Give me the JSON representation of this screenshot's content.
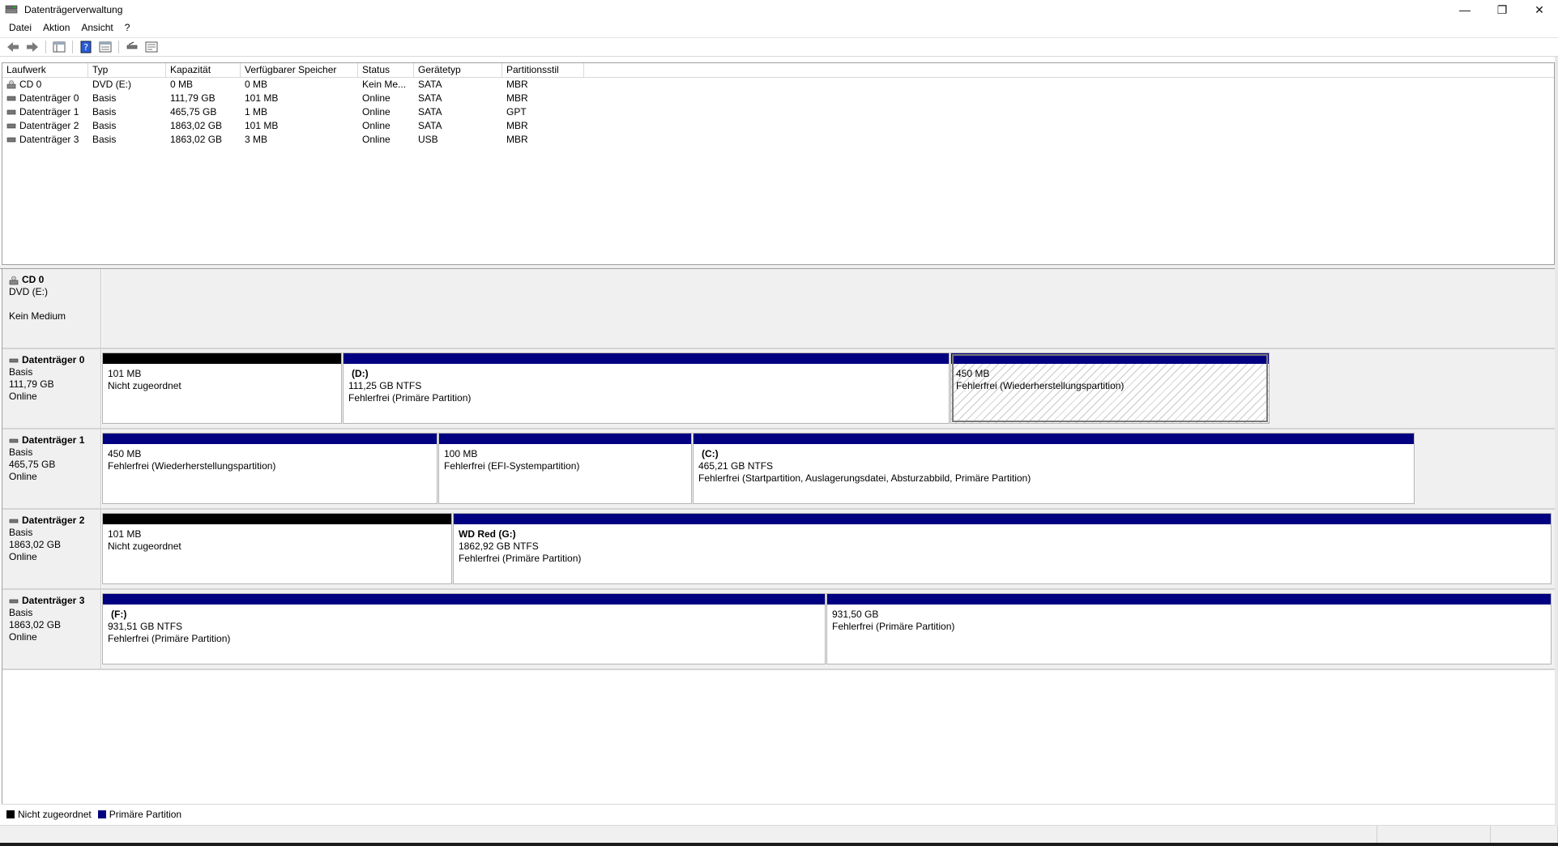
{
  "window": {
    "title": "Datenträgerverwaltung",
    "minimize": "—",
    "restore": "❐",
    "close": "✕"
  },
  "menu": [
    "Datei",
    "Aktion",
    "Ansicht",
    "?"
  ],
  "toolbar": {
    "icons": [
      "back-arrow-icon",
      "forward-arrow-icon",
      "console-view-icon",
      "help-icon",
      "properties-view-icon",
      "rescan-icon",
      "settings-view-icon"
    ]
  },
  "listview": {
    "columns": [
      "Laufwerk",
      "Typ",
      "Kapazität",
      "Verfügbarer Speicher",
      "Status",
      "Gerätetyp",
      "Partitionsstil"
    ],
    "rows": [
      {
        "name": "CD 0",
        "icon": "cd-drive-icon",
        "typ": "DVD (E:)",
        "kapazitaet": "0 MB",
        "frei": "0 MB",
        "status": "Kein Me...",
        "geraetetyp": "SATA",
        "stil": "MBR"
      },
      {
        "name": "Datenträger 0",
        "icon": "disk-icon",
        "typ": "Basis",
        "kapazitaet": "111,79 GB",
        "frei": "101 MB",
        "status": "Online",
        "geraetetyp": "SATA",
        "stil": "MBR"
      },
      {
        "name": "Datenträger 1",
        "icon": "disk-icon",
        "typ": "Basis",
        "kapazitaet": "465,75 GB",
        "frei": "1 MB",
        "status": "Online",
        "geraetetyp": "SATA",
        "stil": "GPT"
      },
      {
        "name": "Datenträger 2",
        "icon": "disk-icon",
        "typ": "Basis",
        "kapazitaet": "1863,02 GB",
        "frei": "101 MB",
        "status": "Online",
        "geraetetyp": "SATA",
        "stil": "MBR"
      },
      {
        "name": "Datenträger 3",
        "icon": "disk-icon",
        "typ": "Basis",
        "kapazitaet": "1863,02 GB",
        "frei": "3 MB",
        "status": "Online",
        "geraetetyp": "USB",
        "stil": "MBR"
      }
    ]
  },
  "disks": {
    "cd0": {
      "name": "CD 0",
      "line1": "DVD (E:)",
      "line2": "",
      "line3": "Kein Medium"
    },
    "d0": {
      "name": "Datenträger 0",
      "line1": "Basis",
      "line2": "111,79 GB",
      "line3": "Online",
      "parts": [
        {
          "title": "",
          "size": "101 MB",
          "status": "Nicht zugeordnet"
        },
        {
          "title": "(D:)",
          "size": "111,25 GB NTFS",
          "status": "Fehlerfrei (Primäre Partition)"
        },
        {
          "title": "",
          "size": "450 MB",
          "status": "Fehlerfrei (Wiederherstellungspartition)"
        }
      ]
    },
    "d1": {
      "name": "Datenträger 1",
      "line1": "Basis",
      "line2": "465,75 GB",
      "line3": "Online",
      "parts": [
        {
          "title": "",
          "size": "450 MB",
          "status": "Fehlerfrei (Wiederherstellungspartition)"
        },
        {
          "title": "",
          "size": "100 MB",
          "status": "Fehlerfrei (EFI-Systempartition)"
        },
        {
          "title": "(C:)",
          "size": "465,21 GB NTFS",
          "status": "Fehlerfrei (Startpartition, Auslagerungsdatei, Absturzabbild, Primäre Partition)"
        }
      ]
    },
    "d2": {
      "name": "Datenträger 2",
      "line1": "Basis",
      "line2": "1863,02 GB",
      "line3": "Online",
      "parts": [
        {
          "title": "",
          "size": "101 MB",
          "status": "Nicht zugeordnet"
        },
        {
          "title": "WD Red  (G:)",
          "size": "1862,92 GB NTFS",
          "status": "Fehlerfrei (Primäre Partition)"
        }
      ]
    },
    "d3": {
      "name": "Datenträger 3",
      "line1": "Basis",
      "line2": "1863,02 GB",
      "line3": "Online",
      "parts": [
        {
          "title": "(F:)",
          "size": "931,51 GB NTFS",
          "status": "Fehlerfrei (Primäre Partition)"
        },
        {
          "title": "",
          "size": "931,50 GB",
          "status": "Fehlerfrei (Primäre Partition)"
        }
      ]
    }
  },
  "legend": {
    "unalloc": "Nicht zugeordnet",
    "primary": "Primäre Partition",
    "unalloc_color": "#000000",
    "primary_color": "#000080"
  }
}
